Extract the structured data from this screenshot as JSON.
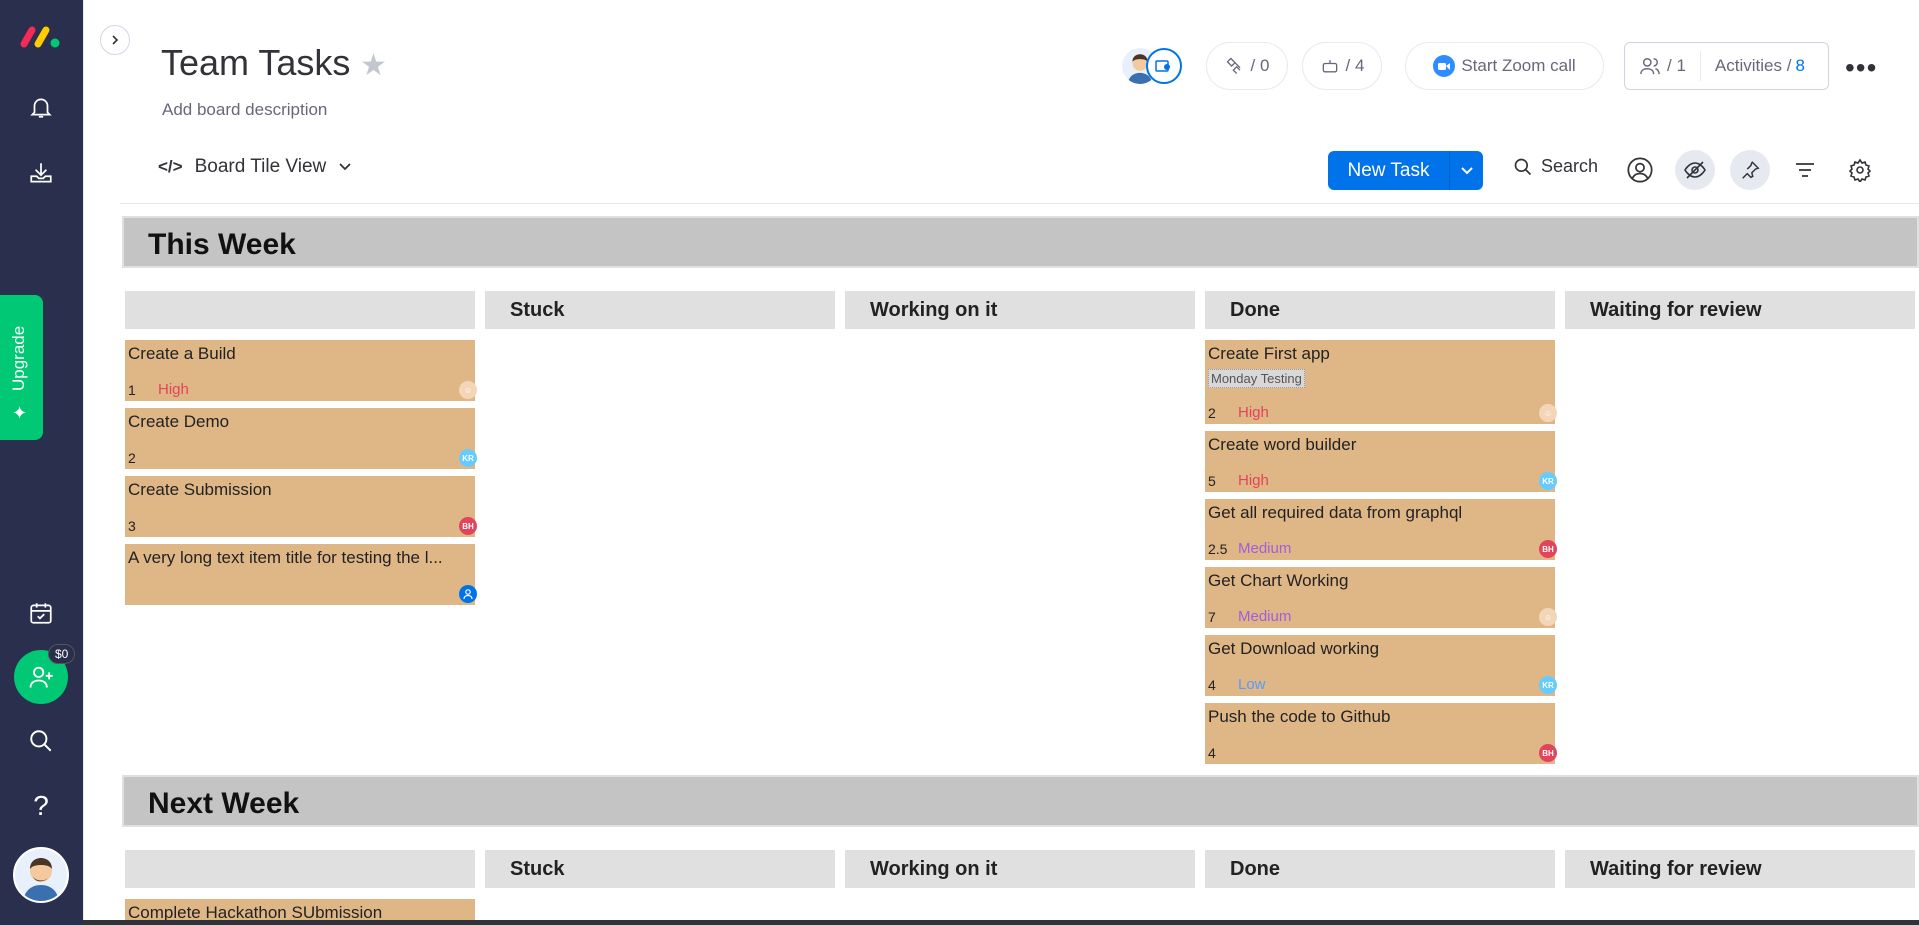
{
  "board": {
    "title": "Team Tasks",
    "description": "Add board description"
  },
  "header": {
    "updates_count": "/ 0",
    "automations_count": "/ 4",
    "zoom_label": "Start Zoom call",
    "members_count": "/ 1",
    "activities_label": "Activities /",
    "activities_count": "8"
  },
  "toolbar": {
    "view_label": "Board Tile View",
    "new_task_label": "New Task",
    "search_label": "Search"
  },
  "sidebar": {
    "upgrade_label": "Upgrade",
    "invite_badge": "$0"
  },
  "columns": [
    "",
    "Stuck",
    "Working on it",
    "Done",
    "Waiting for review"
  ],
  "groups": [
    {
      "name": "This Week",
      "columns": [
        {
          "title": "",
          "cards": [
            {
              "name": "Create a Build",
              "num": "1",
              "priority": "High",
              "avatar": "face"
            },
            {
              "name": "Create Demo",
              "num": "2",
              "priority": "",
              "avatar": "KR"
            },
            {
              "name": "Create Submission",
              "num": "3",
              "priority": "",
              "avatar": "BH"
            },
            {
              "name": "A very long text item title for testing the l...",
              "num": "",
              "priority": "",
              "avatar": "user"
            }
          ]
        },
        {
          "title": "Stuck",
          "cards": []
        },
        {
          "title": "Working on it",
          "cards": []
        },
        {
          "title": "Done",
          "cards": [
            {
              "name": "Create First app",
              "tag": "Monday Testing",
              "num": "2",
              "priority": "High",
              "avatar": "face"
            },
            {
              "name": "Create word builder",
              "num": "5",
              "priority": "High",
              "avatar": "KR"
            },
            {
              "name": "Get all required data from graphql",
              "num": "2.5",
              "priority": "Medium",
              "avatar": "BH"
            },
            {
              "name": "Get Chart Working",
              "num": "7",
              "priority": "Medium",
              "avatar": "face"
            },
            {
              "name": "Get Download working",
              "num": "4",
              "priority": "Low",
              "avatar": "KR"
            },
            {
              "name": "Push the code to Github",
              "num": "4",
              "priority": "",
              "avatar": "BH"
            }
          ]
        },
        {
          "title": "Waiting for review",
          "cards": []
        }
      ]
    },
    {
      "name": "Next Week",
      "columns": [
        {
          "title": "",
          "cards": [
            {
              "name": "Complete Hackathon SUbmission",
              "num": "",
              "priority": "",
              "avatar": ""
            }
          ]
        },
        {
          "title": "Stuck",
          "cards": []
        },
        {
          "title": "Working on it",
          "cards": []
        },
        {
          "title": "Done",
          "cards": []
        },
        {
          "title": "Waiting for review",
          "cards": []
        }
      ]
    }
  ],
  "avatar_initials": {
    "KR": "KR",
    "BH": "BH"
  },
  "colors": {
    "accent": "#0073ea",
    "sidebar": "#292f4c",
    "upgrade": "#00c875",
    "card": "#dfb786",
    "high": "#e2445c",
    "medium": "#a25ddc",
    "low": "#579bfc"
  }
}
